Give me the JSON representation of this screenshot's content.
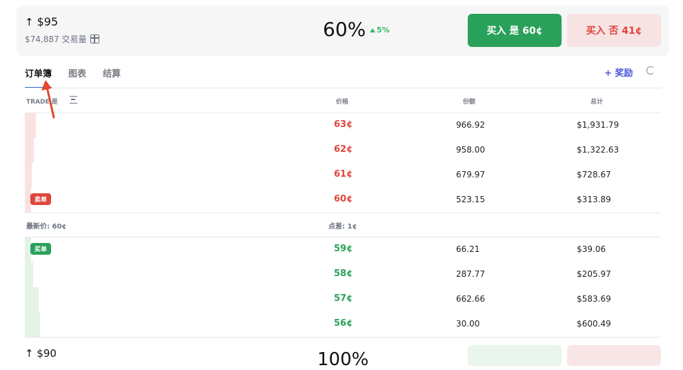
{
  "top_market": {
    "price_label": "$95",
    "volume_label": "$74,887 交易量",
    "chance": "60%",
    "change": "5%",
    "buy_yes": "买入 是 60¢",
    "buy_no": "买入 否 41¢"
  },
  "tabs": [
    {
      "label": "订单簿",
      "active": true
    },
    {
      "label": "图表",
      "active": false
    },
    {
      "label": "结算",
      "active": false
    }
  ],
  "rewards_label": "+ 奖励",
  "orderbook": {
    "headers": {
      "trade": "TRADE 是",
      "price": "价格",
      "shares": "份额",
      "total": "总计"
    },
    "asks": [
      {
        "price": "63¢",
        "shares": "966.92",
        "total": "$1,931.79",
        "depth": 0.017
      },
      {
        "price": "62¢",
        "shares": "958.00",
        "total": "$1,322.63",
        "depth": 0.014
      },
      {
        "price": "61¢",
        "shares": "679.97",
        "total": "$728.67",
        "depth": 0.011
      },
      {
        "price": "60¢",
        "shares": "523.15",
        "total": "$313.89",
        "depth": 0.01
      }
    ],
    "ask_tag": "卖单",
    "last_price": "最新价: 60¢",
    "spread": "点差: 1¢",
    "bid_tag": "买单",
    "bids": [
      {
        "price": "59¢",
        "shares": "66.21",
        "total": "$39.06",
        "depth": 0.01
      },
      {
        "price": "58¢",
        "shares": "287.77",
        "total": "$205.97",
        "depth": 0.013
      },
      {
        "price": "57¢",
        "shares": "662.66",
        "total": "$583.69",
        "depth": 0.022
      },
      {
        "price": "56¢",
        "shares": "30.00",
        "total": "$600.49",
        "depth": 0.024
      }
    ]
  },
  "next_market": {
    "price_label": "$90",
    "chance": "100%"
  },
  "colors": {
    "yes": "#2aa15a",
    "no": "#e0453c",
    "accent": "#3b6ad8"
  }
}
